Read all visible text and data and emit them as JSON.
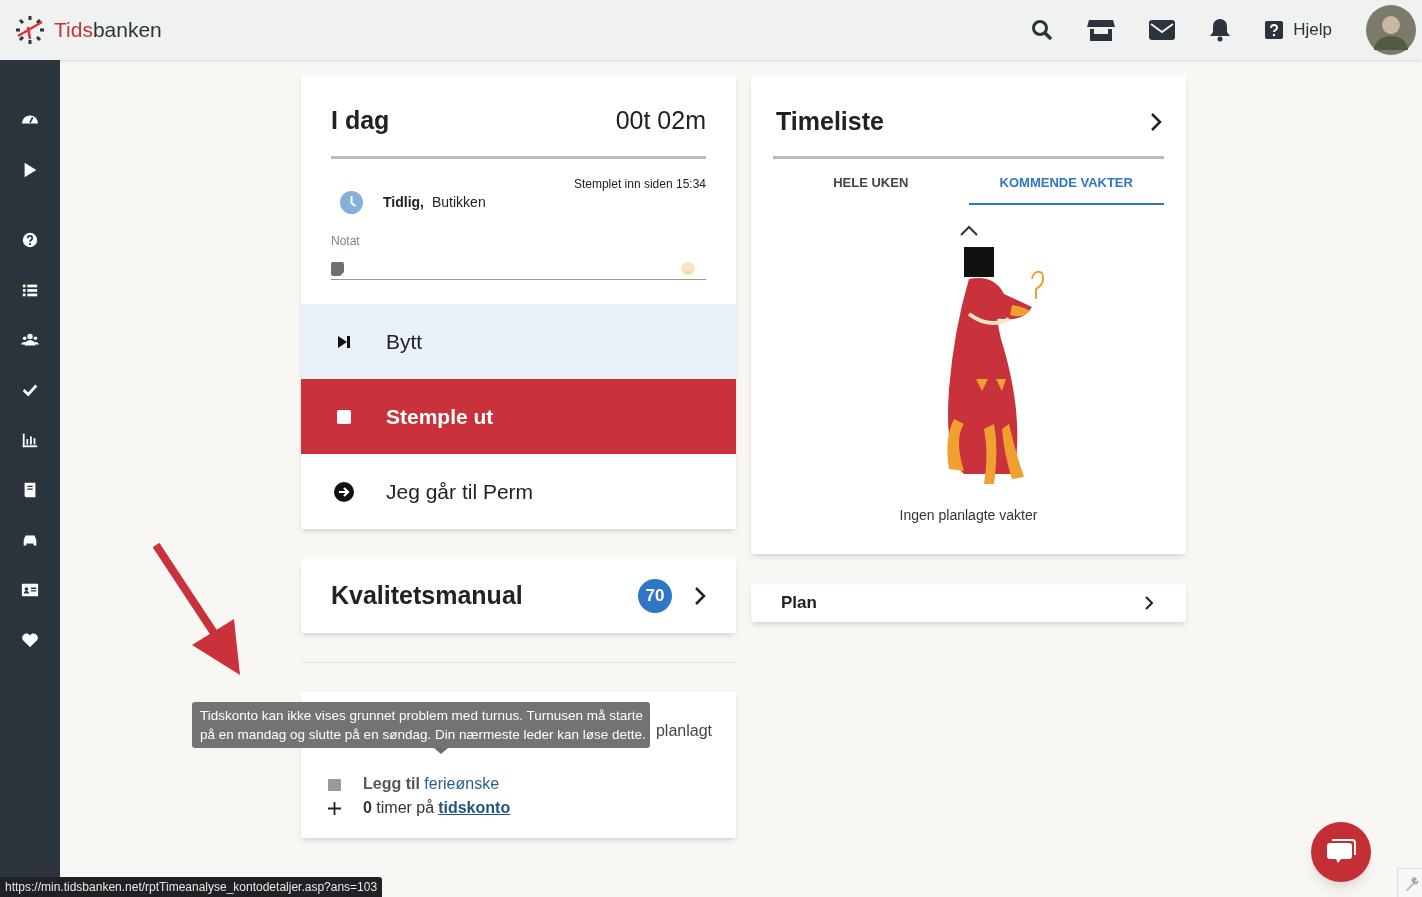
{
  "header": {
    "logo_red": "Tids",
    "logo_dark": "banken",
    "help": "Hjelp"
  },
  "today": {
    "title": "I dag",
    "duration": "00t 02m",
    "stamped": "Stemplet inn siden 15:34",
    "shift": "Tidlig,",
    "location": "Butikken",
    "note_label": "Notat",
    "actions": [
      {
        "kind": "switch",
        "label": "Bytt"
      },
      {
        "kind": "stop",
        "label": "Stemple ut"
      },
      {
        "kind": "leave",
        "label": "Jeg går til Perm"
      }
    ]
  },
  "manual": {
    "title": "Kvalitetsmanual",
    "count": "70"
  },
  "vacation": {
    "summary": "planlagt",
    "add_bold": "Legg til",
    "add_link": "ferieønske",
    "hours_bold": "0",
    "hours_text": "timer på",
    "hours_link": "tidskonto"
  },
  "tooltip": "Tidskonto kan ikke vises grunnet problem med turnus. Turnusen må starte på en mandag og slutte på en søndag. Din nærmeste leder kan løse dette.",
  "timesheet": {
    "title": "Timeliste",
    "tabs": [
      {
        "label": "HELE UKEN",
        "selected": false
      },
      {
        "label": "KOMMENDE VAKTER",
        "selected": true
      }
    ],
    "empty": "Ingen planlagte vakter"
  },
  "plan": {
    "title": "Plan"
  },
  "status_url": "https://min.tidsbanken.net/rptTimeanalyse_kontodetaljer.asp?ans=103"
}
